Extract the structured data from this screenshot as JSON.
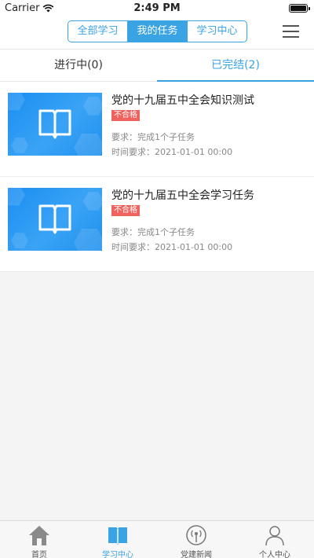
{
  "status_bar": {
    "carrier": "Carrier",
    "time": "2:49 PM"
  },
  "nav": {
    "segments": [
      {
        "label": "全部学习",
        "active": false
      },
      {
        "label": "我的任务",
        "active": true
      },
      {
        "label": "学习中心",
        "active": false
      }
    ],
    "menu_icon": "hamburger-icon"
  },
  "tabs": [
    {
      "label": "进行中(0)",
      "active": false
    },
    {
      "label": "已完结(2)",
      "active": true
    }
  ],
  "tasks": [
    {
      "title": "党的十九届五中全会知识测试",
      "badge": "不合格",
      "requirement": "要求：完成1个子任务",
      "time_requirement": "时间要求：2021-01-01 00:00",
      "thumbnail_icon": "book-icon"
    },
    {
      "title": "党的十九届五中全会学习任务",
      "badge": "不合格",
      "requirement": "要求：完成1个子任务",
      "time_requirement": "时间要求：2021-01-01 00:00",
      "thumbnail_icon": "book-icon"
    }
  ],
  "bottom_nav": [
    {
      "label": "首页",
      "icon": "home-icon",
      "active": false
    },
    {
      "label": "学习中心",
      "icon": "book-icon",
      "active": true
    },
    {
      "label": "党建新闻",
      "icon": "broadcast-icon",
      "active": false
    },
    {
      "label": "个人中心",
      "icon": "person-icon",
      "active": false
    }
  ],
  "colors": {
    "accent": "#3aa3e3",
    "badge": "#f0625d",
    "thumbnail": "#1a8ef2"
  }
}
